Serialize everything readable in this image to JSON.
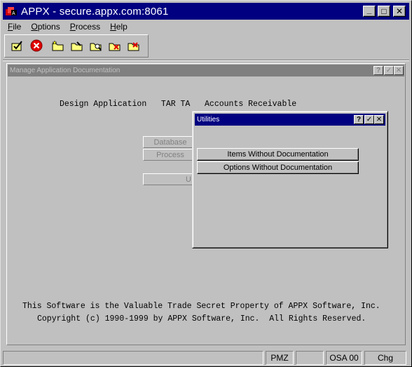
{
  "window": {
    "title": "APPX - secure.appx.com:8061",
    "controls": {
      "minimize": "_",
      "maximize": "□",
      "close": "✕"
    }
  },
  "menu": {
    "items": [
      "File",
      "Options",
      "Process",
      "Help"
    ]
  },
  "toolbar": {
    "icons": [
      "check-icon",
      "cancel-icon",
      "folder-star-icon",
      "folder-edit-icon",
      "folder-search-icon",
      "folder-delete-icon",
      "folder-check-icon"
    ]
  },
  "inner_window": {
    "title": "Manage Application Documentation",
    "controls": {
      "help": "?",
      "ok": "✓",
      "close": "✕"
    },
    "header_line": "Design Application   TAR TA   Accounts Receivable",
    "buttons": [
      "Database",
      "Process",
      "U"
    ],
    "footer_line1": "This Software is the Valuable Trade Secret Property of APPX Software, Inc.",
    "footer_line2": "Copyright (c) 1990-1999 by APPX Software, Inc.  All Rights Reserved."
  },
  "dialog": {
    "title": "Utilities",
    "controls": {
      "help": "?",
      "ok": "✓",
      "close": "✕"
    },
    "options": [
      "Items Without Documentation",
      "Options Without Documentation"
    ]
  },
  "status": {
    "panels": [
      "",
      "PMZ",
      "",
      "OSA 00",
      "Chg"
    ]
  },
  "colors": {
    "titlebar": "#000080",
    "face": "#c0c0c0",
    "inactive_title": "#808080"
  }
}
